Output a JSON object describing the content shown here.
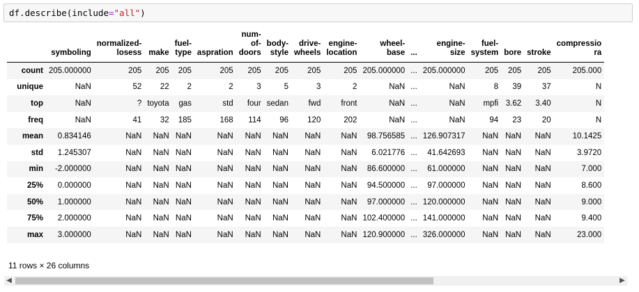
{
  "code": {
    "prefix": "df.describe(include",
    "op": "=",
    "arg": "\"all\"",
    "suffix": ")"
  },
  "columns": [
    "symboling",
    "normalized-\nlosess",
    "make",
    "fuel-\ntype",
    "aspration",
    "num-\nof-\ndoors",
    "body-\nstyle",
    "drive-\nwheels",
    "engine-\nlocation",
    "wheel-\nbase",
    "...",
    "engine-\nsize",
    "fuel-\nsystem",
    "bore",
    "stroke",
    "compressio\nra"
  ],
  "rows": [
    {
      "label": "count",
      "cells": [
        "205.000000",
        "205",
        "205",
        "205",
        "205",
        "205",
        "205",
        "205",
        "205",
        "205.000000",
        "...",
        "205.000000",
        "205",
        "205",
        "205",
        "205.000"
      ]
    },
    {
      "label": "unique",
      "cells": [
        "NaN",
        "52",
        "22",
        "2",
        "2",
        "3",
        "5",
        "3",
        "2",
        "NaN",
        "...",
        "NaN",
        "8",
        "39",
        "37",
        "N"
      ]
    },
    {
      "label": "top",
      "cells": [
        "NaN",
        "?",
        "toyota",
        "gas",
        "std",
        "four",
        "sedan",
        "fwd",
        "front",
        "NaN",
        "...",
        "NaN",
        "mpfi",
        "3.62",
        "3.40",
        "N"
      ]
    },
    {
      "label": "freq",
      "cells": [
        "NaN",
        "41",
        "32",
        "185",
        "168",
        "114",
        "96",
        "120",
        "202",
        "NaN",
        "...",
        "NaN",
        "94",
        "23",
        "20",
        "N"
      ]
    },
    {
      "label": "mean",
      "cells": [
        "0.834146",
        "NaN",
        "NaN",
        "NaN",
        "NaN",
        "NaN",
        "NaN",
        "NaN",
        "NaN",
        "98.756585",
        "...",
        "126.907317",
        "NaN",
        "NaN",
        "NaN",
        "10.1425"
      ]
    },
    {
      "label": "std",
      "cells": [
        "1.245307",
        "NaN",
        "NaN",
        "NaN",
        "NaN",
        "NaN",
        "NaN",
        "NaN",
        "NaN",
        "6.021776",
        "...",
        "41.642693",
        "NaN",
        "NaN",
        "NaN",
        "3.9720"
      ]
    },
    {
      "label": "min",
      "cells": [
        "-2.000000",
        "NaN",
        "NaN",
        "NaN",
        "NaN",
        "NaN",
        "NaN",
        "NaN",
        "NaN",
        "86.600000",
        "...",
        "61.000000",
        "NaN",
        "NaN",
        "NaN",
        "7.000"
      ]
    },
    {
      "label": "25%",
      "cells": [
        "0.000000",
        "NaN",
        "NaN",
        "NaN",
        "NaN",
        "NaN",
        "NaN",
        "NaN",
        "NaN",
        "94.500000",
        "...",
        "97.000000",
        "NaN",
        "NaN",
        "NaN",
        "8.600"
      ]
    },
    {
      "label": "50%",
      "cells": [
        "1.000000",
        "NaN",
        "NaN",
        "NaN",
        "NaN",
        "NaN",
        "NaN",
        "NaN",
        "NaN",
        "97.000000",
        "...",
        "120.000000",
        "NaN",
        "NaN",
        "NaN",
        "9.000"
      ]
    },
    {
      "label": "75%",
      "cells": [
        "2.000000",
        "NaN",
        "NaN",
        "NaN",
        "NaN",
        "NaN",
        "NaN",
        "NaN",
        "NaN",
        "102.400000",
        "...",
        "141.000000",
        "NaN",
        "NaN",
        "NaN",
        "9.400"
      ]
    },
    {
      "label": "max",
      "cells": [
        "3.000000",
        "NaN",
        "NaN",
        "NaN",
        "NaN",
        "NaN",
        "NaN",
        "NaN",
        "NaN",
        "120.900000",
        "...",
        "326.000000",
        "NaN",
        "NaN",
        "NaN",
        "23.000"
      ]
    }
  ],
  "shape_text": "11 rows × 26 columns",
  "scrollbar": {
    "left_icon": "scroll-left-arrow-icon",
    "right_icon": "scroll-right-arrow-icon"
  }
}
